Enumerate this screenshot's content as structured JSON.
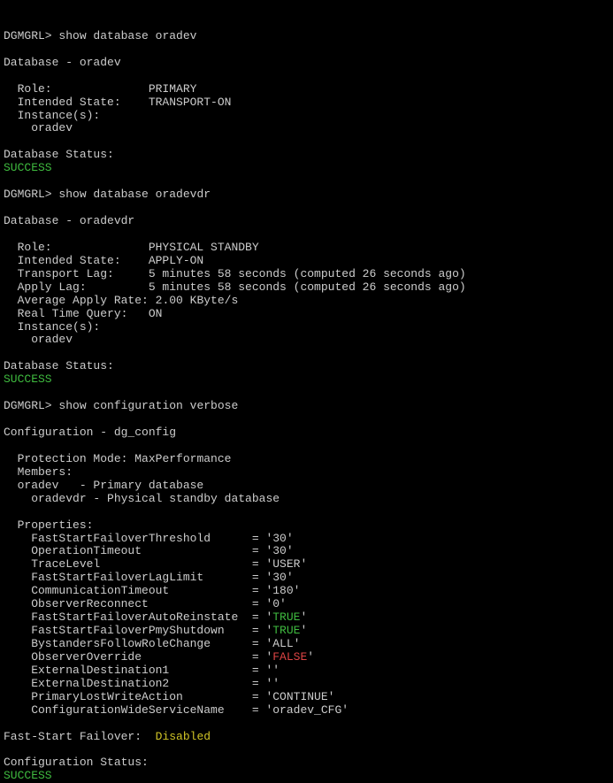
{
  "prompt": "DGMGRL> ",
  "cmd1": "show database oradev",
  "db1": {
    "header": "Database - oradev",
    "role_label": "  Role:              ",
    "role": "PRIMARY",
    "istate_label": "  Intended State:    ",
    "istate": "TRANSPORT-ON",
    "instances_label": "  Instance(s):",
    "inst1": "    oradev",
    "status_label": "Database Status:",
    "status": "SUCCESS"
  },
  "cmd2": "show database oradevdr",
  "db2": {
    "header": "Database - oradevdr",
    "role_label": "  Role:              ",
    "role": "PHYSICAL STANDBY",
    "istate_label": "  Intended State:    ",
    "istate": "APPLY-ON",
    "tlag_label": "  Transport Lag:     ",
    "tlag": "5 minutes 58 seconds (computed 26 seconds ago)",
    "alag_label": "  Apply Lag:         ",
    "alag": "5 minutes 58 seconds (computed 26 seconds ago)",
    "rate_label": "  Average Apply Rate: ",
    "rate": "2.00 KByte/s",
    "rtq_label": "  Real Time Query:   ",
    "rtq": "ON",
    "instances_label": "  Instance(s):",
    "inst1": "    oradev",
    "status_label": "Database Status:",
    "status": "SUCCESS"
  },
  "cmd3": "show configuration verbose",
  "cfg": {
    "header": "Configuration - dg_config",
    "prot_label": "  Protection Mode: ",
    "prot": "MaxPerformance",
    "members_label": "  Members:",
    "m1": "  oradev   - Primary database",
    "m2": "    oradevdr - Physical standby database",
    "props_label": "  Properties:",
    "p1": "    FastStartFailoverThreshold      = '30'",
    "p2": "    OperationTimeout                = '30'",
    "p3": "    TraceLevel                      = 'USER'",
    "p4": "    FastStartFailoverLagLimit       = '30'",
    "p5": "    CommunicationTimeout            = '180'",
    "p6": "    ObserverReconnect               = '0'",
    "p7l": "    FastStartFailoverAutoReinstate  = '",
    "p7v": "TRUE",
    "p7r": "'",
    "p8l": "    FastStartFailoverPmyShutdown    = '",
    "p8v": "TRUE",
    "p8r": "'",
    "p9": "    BystandersFollowRoleChange      = 'ALL'",
    "p10l": "    ObserverOverride                = '",
    "p10v": "FALSE",
    "p10r": "'",
    "p11": "    ExternalDestination1            = ''",
    "p12": "    ExternalDestination2            = ''",
    "p13": "    PrimaryLostWriteAction          = 'CONTINUE'",
    "p14": "    ConfigurationWideServiceName    = 'oradev_CFG'",
    "fsfo_label": "Fast-Start Failover:  ",
    "fsfo": "Disabled",
    "status_label": "Configuration Status:",
    "status": "SUCCESS"
  }
}
